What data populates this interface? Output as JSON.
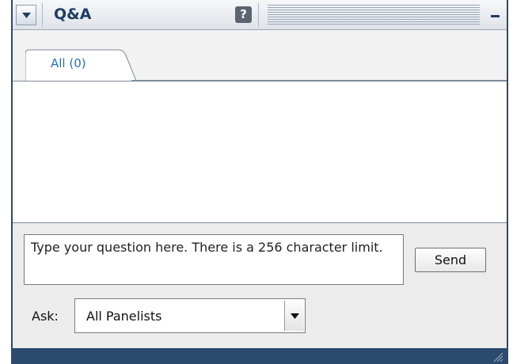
{
  "panel": {
    "title": "Q&A",
    "help_label": "?"
  },
  "tabs": [
    {
      "label": "All (0)"
    }
  ],
  "question": {
    "text": "Type your question here. There is a 256 character limit."
  },
  "send_label": "Send",
  "ask": {
    "label": "Ask:",
    "selected": "All Panelists"
  },
  "icons": {
    "collapse": "triangle-down-icon",
    "help": "help-icon",
    "minimize": "minimize-icon",
    "dropdown": "chevron-down-icon",
    "resize": "resize-grip-icon"
  },
  "colors": {
    "frame": "#2b4a6e",
    "title_text": "#1f3d63",
    "tab_text": "#2a6fc4",
    "panel_bg": "#ececec"
  }
}
